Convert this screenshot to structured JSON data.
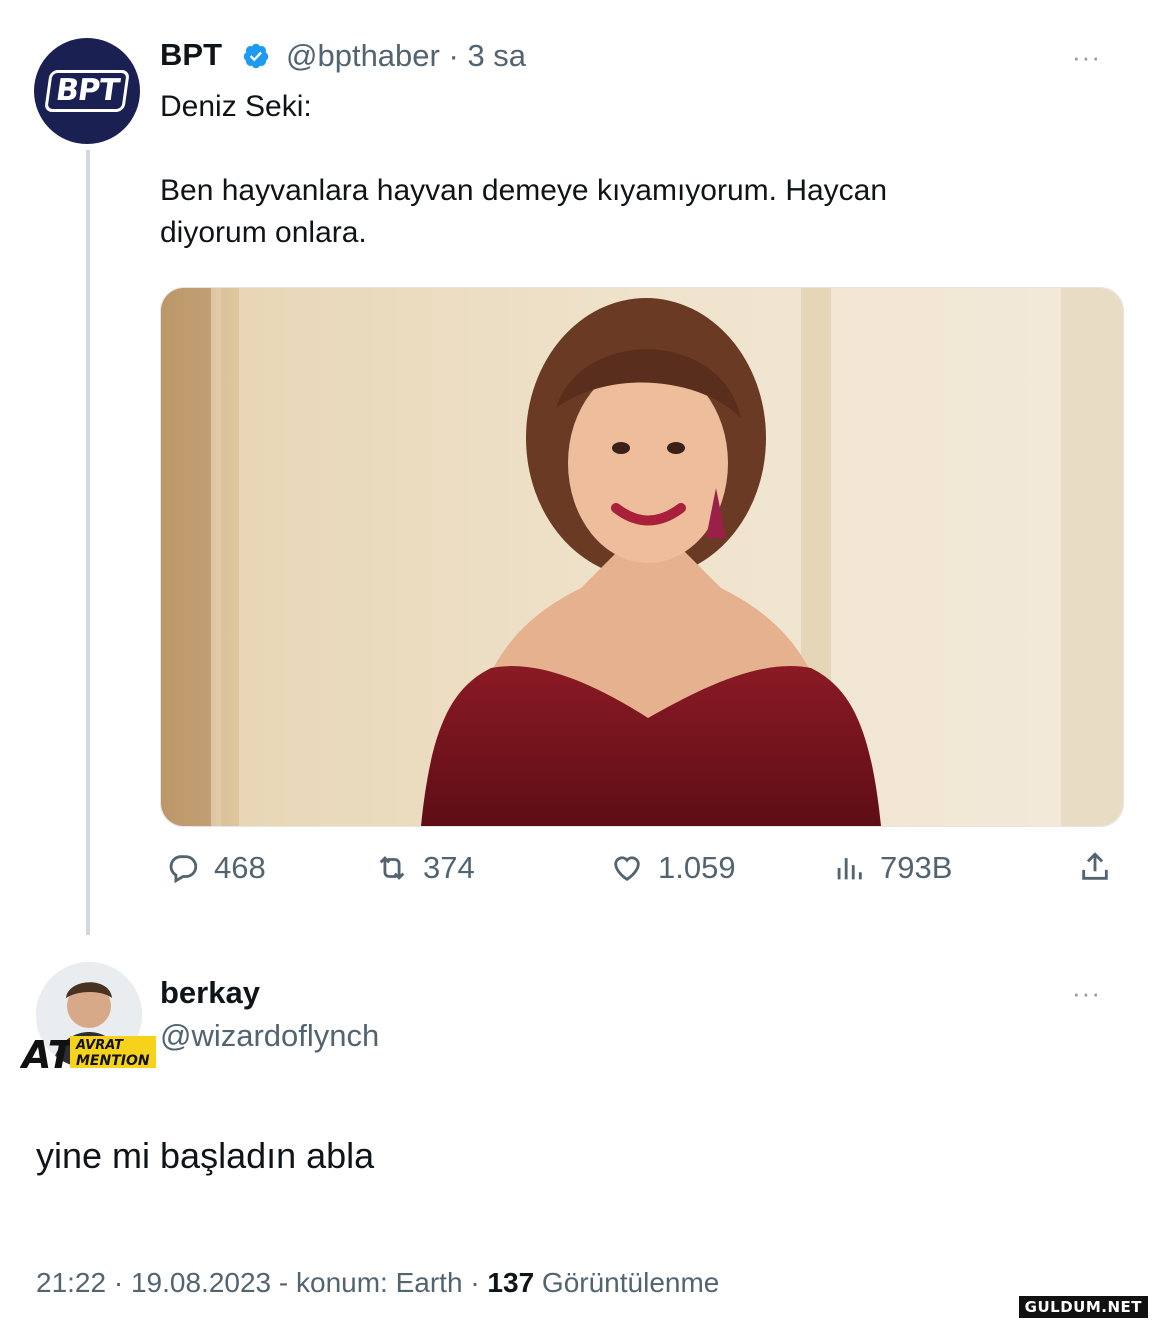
{
  "tweet": {
    "author_name": "BPT",
    "handle": "@bpthaber",
    "separator": "·",
    "time": "3 sa",
    "more": "···",
    "text": "Deniz Seki:\n\nBen hayvanlara hayvan demeye kıyamıyorum. Haycan\ndiyorum onlara.",
    "stats": {
      "replies": "468",
      "retweets": "374",
      "likes": "1.059",
      "views": "793B"
    },
    "avatar_logo": "BPT"
  },
  "reply": {
    "author_name": "berkay",
    "handle": "@wizardoflynch",
    "more": "···",
    "badge_text_top": "AVRAT",
    "badge_text_bottom": "MENTION",
    "badge_letters": "AT",
    "text": "yine mi başladın abla",
    "time": "21:22",
    "date": "19.08.2023",
    "location": "konum: Earth",
    "views_count": "137",
    "views_label": "Görüntülenme"
  },
  "watermark": "GULDUM.NET",
  "colors": {
    "text": "#0f1419",
    "secondary": "#536471",
    "verified": "#1d9bf0",
    "thread_line": "#cfd9de",
    "avatar_bg": "#1a2052"
  }
}
